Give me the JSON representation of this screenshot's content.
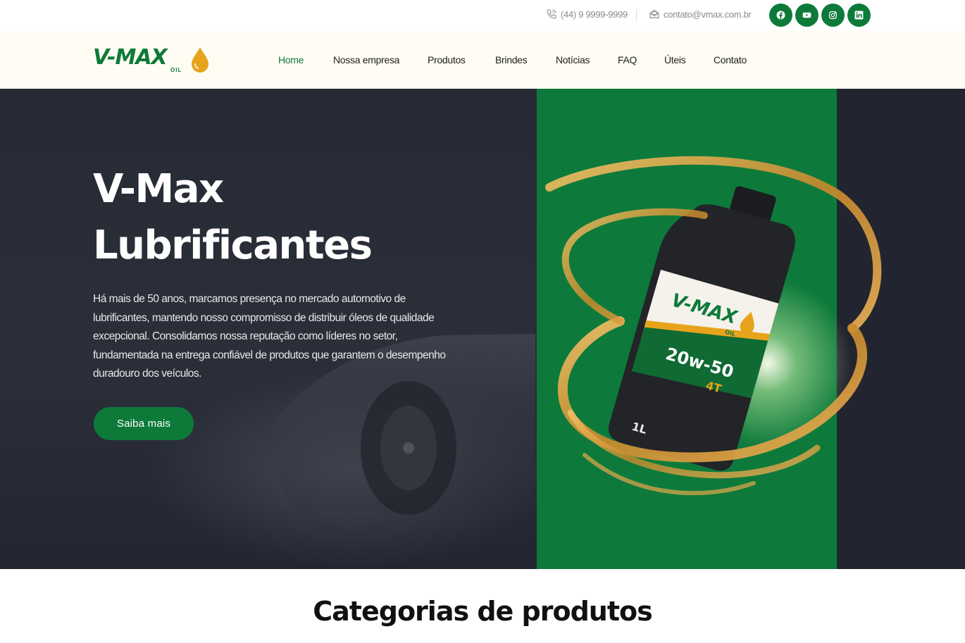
{
  "topbar": {
    "phone": "(44) 9 9999-9999",
    "email": "contato@vmax.com.br",
    "social": [
      {
        "icon": "facebook-icon"
      },
      {
        "icon": "youtube-icon"
      },
      {
        "icon": "instagram-icon"
      },
      {
        "icon": "linkedin-icon"
      }
    ]
  },
  "header": {
    "logo_word": "V-MAX",
    "logo_sub": "OIL",
    "nav": [
      "Home",
      "Nossa empresa",
      "Produtos",
      "Brindes",
      "Notícias",
      "FAQ",
      "Úteis",
      "Contato"
    ]
  },
  "hero": {
    "title_line1": "V-Max",
    "title_line2": "Lubrificantes",
    "description": "Há mais de 50 anos, marcamos presença no mercado automotivo de lubrificantes, mantendo nosso compromisso de distribuir óleos de qualidade excepcional. Consolidamos nossa reputação como líderes no setor, fundamentada na entrega confiável de produtos que garantem o desempenho duradouro dos veículos.",
    "cta_label": "Saiba mais",
    "bottle": {
      "brand": "V-MAX",
      "brand_sub": "OIL",
      "grade": "20w-50",
      "type": "4T",
      "volume": "1L"
    }
  },
  "categories": {
    "title": "Categorias de produtos"
  },
  "colors": {
    "brand_green": "#0e7a3a",
    "accent_orange": "#e8a31c",
    "hero_dark": "#22252f",
    "header_bg": "#fffdf3"
  }
}
